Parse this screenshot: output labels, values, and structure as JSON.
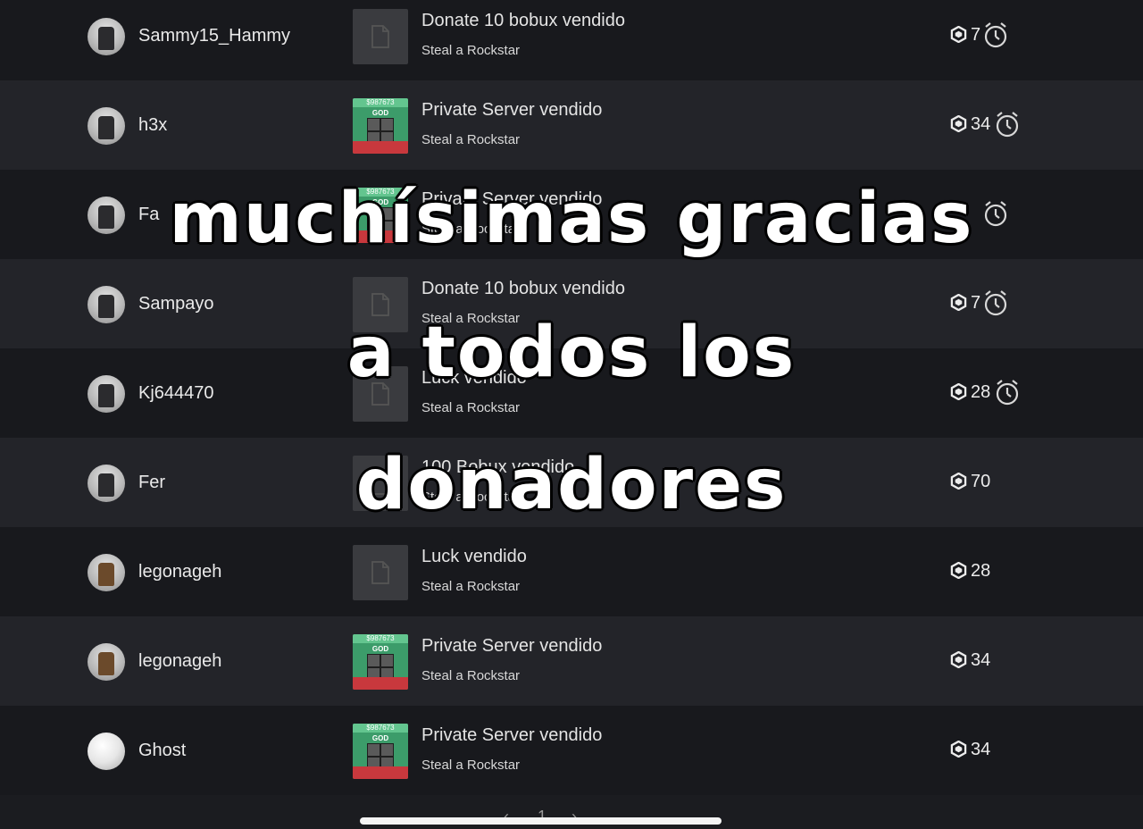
{
  "transactions": [
    {
      "user": "Sammy15_Hammy",
      "title": "Donate 10 bobux vendido",
      "place": "Steal a Rockstar",
      "amount": "7",
      "pending": true,
      "thumb": "placeholder",
      "avatar": "default"
    },
    {
      "user": "h3x",
      "title": "Private Server vendido",
      "place": "Steal a Rockstar",
      "amount": "34",
      "pending": true,
      "thumb": "server",
      "avatar": "default"
    },
    {
      "user": "Fa",
      "title": "Private Server vendido",
      "place": "Steal a Rockstar",
      "amount": "",
      "pending": true,
      "thumb": "server",
      "avatar": "default"
    },
    {
      "user": "Sampayo",
      "title": "Donate 10 bobux vendido",
      "place": "Steal a Rockstar",
      "amount": "7",
      "pending": true,
      "thumb": "placeholder",
      "avatar": "default"
    },
    {
      "user": "Kj644470",
      "title": "Luck vendido",
      "place": "Steal a Rockstar",
      "amount": "28",
      "pending": true,
      "thumb": "placeholder",
      "avatar": "default"
    },
    {
      "user": "Fer",
      "title": "100 Bobux vendido",
      "place": "Steal a Rockstar",
      "amount": "70",
      "pending": false,
      "thumb": "placeholder",
      "avatar": "default"
    },
    {
      "user": "legonageh",
      "title": "Luck vendido",
      "place": "Steal a Rockstar",
      "amount": "28",
      "pending": false,
      "thumb": "placeholder",
      "avatar": "tan"
    },
    {
      "user": "legonageh",
      "title": "Private Server vendido",
      "place": "Steal a Rockstar",
      "amount": "34",
      "pending": false,
      "thumb": "server",
      "avatar": "tan"
    },
    {
      "user": "Ghost",
      "title": "Private Server vendido",
      "place": "Steal a Rockstar",
      "amount": "34",
      "pending": false,
      "thumb": "server",
      "avatar": "ghost"
    }
  ],
  "server_thumb": {
    "price": "$987673",
    "label": "GOD"
  },
  "overlay_caption": [
    "muchísimas gracias",
    "a todos los",
    "donadores"
  ],
  "pagination": {
    "prev": "‹",
    "page": "1",
    "next": "›"
  },
  "icons": {
    "currency": "robux-icon",
    "pending": "pending-clock-icon",
    "placeholder": "placeholder-image-icon"
  }
}
